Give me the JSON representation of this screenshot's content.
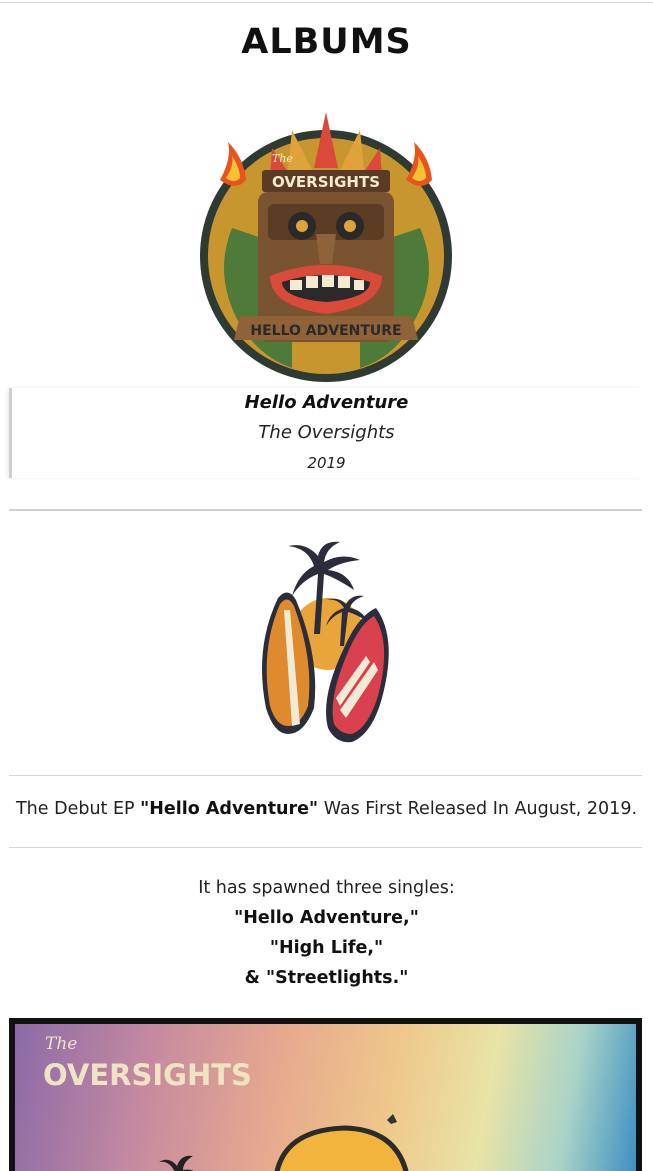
{
  "page": {
    "title": "ALBUMS"
  },
  "album": {
    "name": "Hello Adventure",
    "artist": "The Oversights",
    "year": "2019",
    "art_text": {
      "band": "OVERSIGHTS",
      "the": "The",
      "banner": "HELLO ADVENTURE"
    }
  },
  "debut": {
    "prefix": "The Debut EP ",
    "title": "\"Hello Adventure\"",
    "suffix": " Was First Released In August, 2019."
  },
  "singles": {
    "intro": "It has spawned three singles:",
    "items": [
      "\"Hello Adventure,\"",
      "\"High Life,\"",
      "& \"Streetlights.\""
    ]
  },
  "cover": {
    "the": "The",
    "band": "OVERSIGHTS"
  },
  "colors": {
    "divider": "#d4d4d4",
    "text": "#222222",
    "heading": "#111111"
  }
}
